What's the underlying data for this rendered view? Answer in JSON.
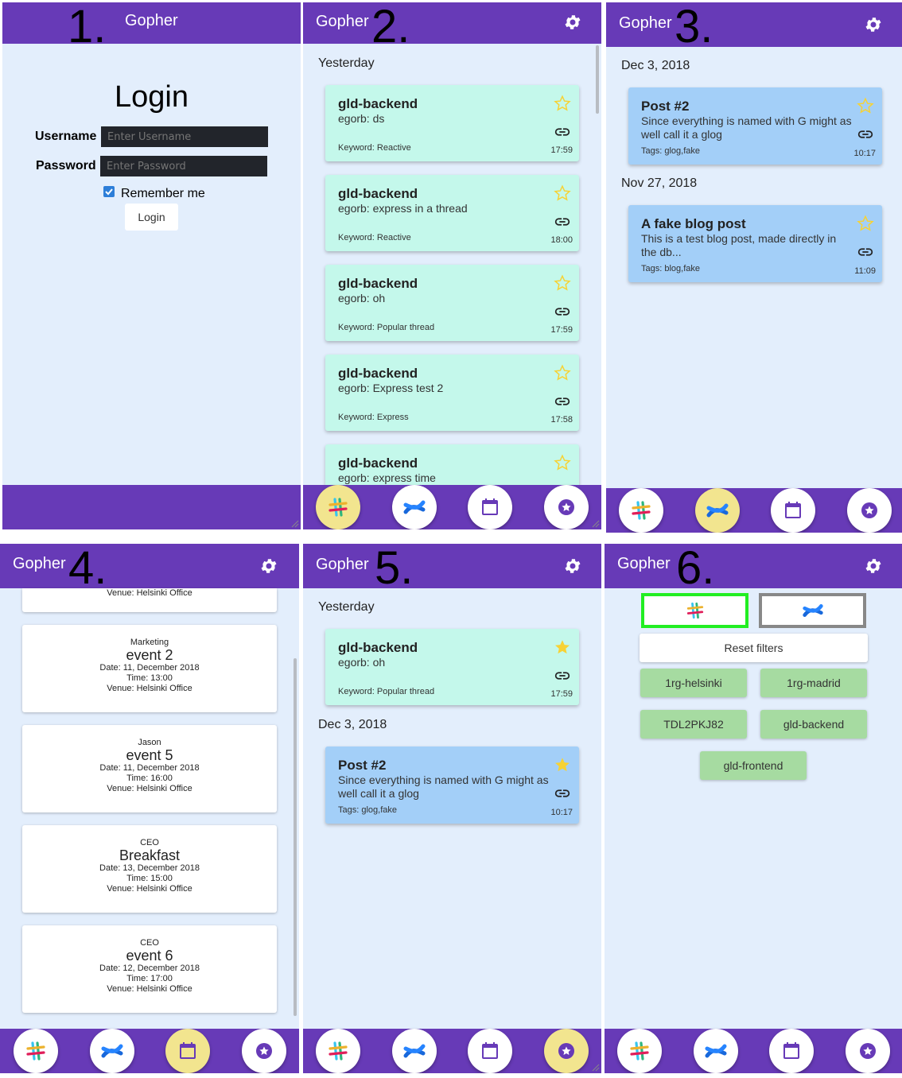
{
  "app_title": "Gopher",
  "panel_numbers": [
    "1.",
    "2.",
    "3.",
    "4.",
    "5.",
    "6."
  ],
  "colors": {
    "appbar": "#673ab7",
    "background": "#e3eefc",
    "slack_card": "#c4f8eb",
    "confluence_card": "#a3cff8",
    "active_nav": "#f2e58f",
    "star": "#f7d234",
    "filter_tag": "#a6dba1",
    "selected_filter_border": "#22ee22"
  },
  "icons": [
    "settings-gear-icon",
    "slack-logo-icon",
    "confluence-logo-icon",
    "calendar-icon",
    "favorite-star-icon",
    "star-icon",
    "link-icon",
    "checkbox-icon"
  ],
  "login": {
    "heading": "Login",
    "username_label": "Username",
    "username_placeholder": "Enter Username",
    "password_label": "Password",
    "password_placeholder": "Enter Password",
    "remember_label": "Remember me",
    "remember_checked": true,
    "button_label": "Login"
  },
  "slack_feed": {
    "date_header": "Yesterday",
    "cards": [
      {
        "title": "gld-backend",
        "body": "egorb: ds",
        "keyword": "Keyword: Reactive",
        "time": "17:59"
      },
      {
        "title": "gld-backend",
        "body": "egorb: express in a thread",
        "keyword": "Keyword: Reactive",
        "time": "18:00"
      },
      {
        "title": "gld-backend",
        "body": "egorb: oh",
        "keyword": "Keyword: Popular thread",
        "time": "17:59"
      },
      {
        "title": "gld-backend",
        "body": "egorb: Express test 2",
        "keyword": "Keyword: Express",
        "time": "17:58"
      },
      {
        "title": "gld-backend",
        "body": "egorb: express time",
        "keyword": "",
        "time": ""
      }
    ]
  },
  "confluence_feed": {
    "groups": [
      {
        "date": "Dec 3, 2018",
        "cards": [
          {
            "title": "Post #2",
            "body": "Since everything is named with G might as well call it a glog",
            "tags": "Tags: glog,fake",
            "time": "10:17"
          }
        ]
      },
      {
        "date": "Nov 27, 2018",
        "cards": [
          {
            "title": "A fake blog post",
            "body": "This is a test blog post, made directly in the db...",
            "tags": "Tags: blog,fake",
            "time": "11:09"
          }
        ]
      }
    ]
  },
  "calendar": {
    "partial_venue": "Venue: Helsinki Office",
    "events": [
      {
        "organizer": "Marketing",
        "name": "event 2",
        "date": "Date: 11, December 2018",
        "time": "Time: 13:00",
        "venue": "Venue: Helsinki Office"
      },
      {
        "organizer": "Jason",
        "name": "event 5",
        "date": "Date: 11, December 2018",
        "time": "Time: 16:00",
        "venue": "Venue: Helsinki Office"
      },
      {
        "organizer": "CEO",
        "name": "Breakfast",
        "date": "Date: 13, December 2018",
        "time": "Time: 15:00",
        "venue": "Venue: Helsinki Office"
      },
      {
        "organizer": "CEO",
        "name": "event 6",
        "date": "Date: 12, December 2018",
        "time": "Time: 17:00",
        "venue": "Venue: Helsinki Office"
      }
    ]
  },
  "favorites": {
    "date_header_1": "Yesterday",
    "slack_card": {
      "title": "gld-backend",
      "body": "egorb: oh",
      "keyword": "Keyword: Popular thread",
      "time": "17:59"
    },
    "date_header_2": "Dec 3, 2018",
    "conf_card": {
      "title": "Post #2",
      "body": "Since everything is named with G might as well call it a glog",
      "tags": "Tags: glog,fake",
      "time": "10:17"
    }
  },
  "filters": {
    "reset_label": "Reset filters",
    "channels": [
      "1rg-helsinki",
      "1rg-madrid",
      "TDL2PKJ82",
      "gld-backend",
      "gld-frontend"
    ]
  }
}
